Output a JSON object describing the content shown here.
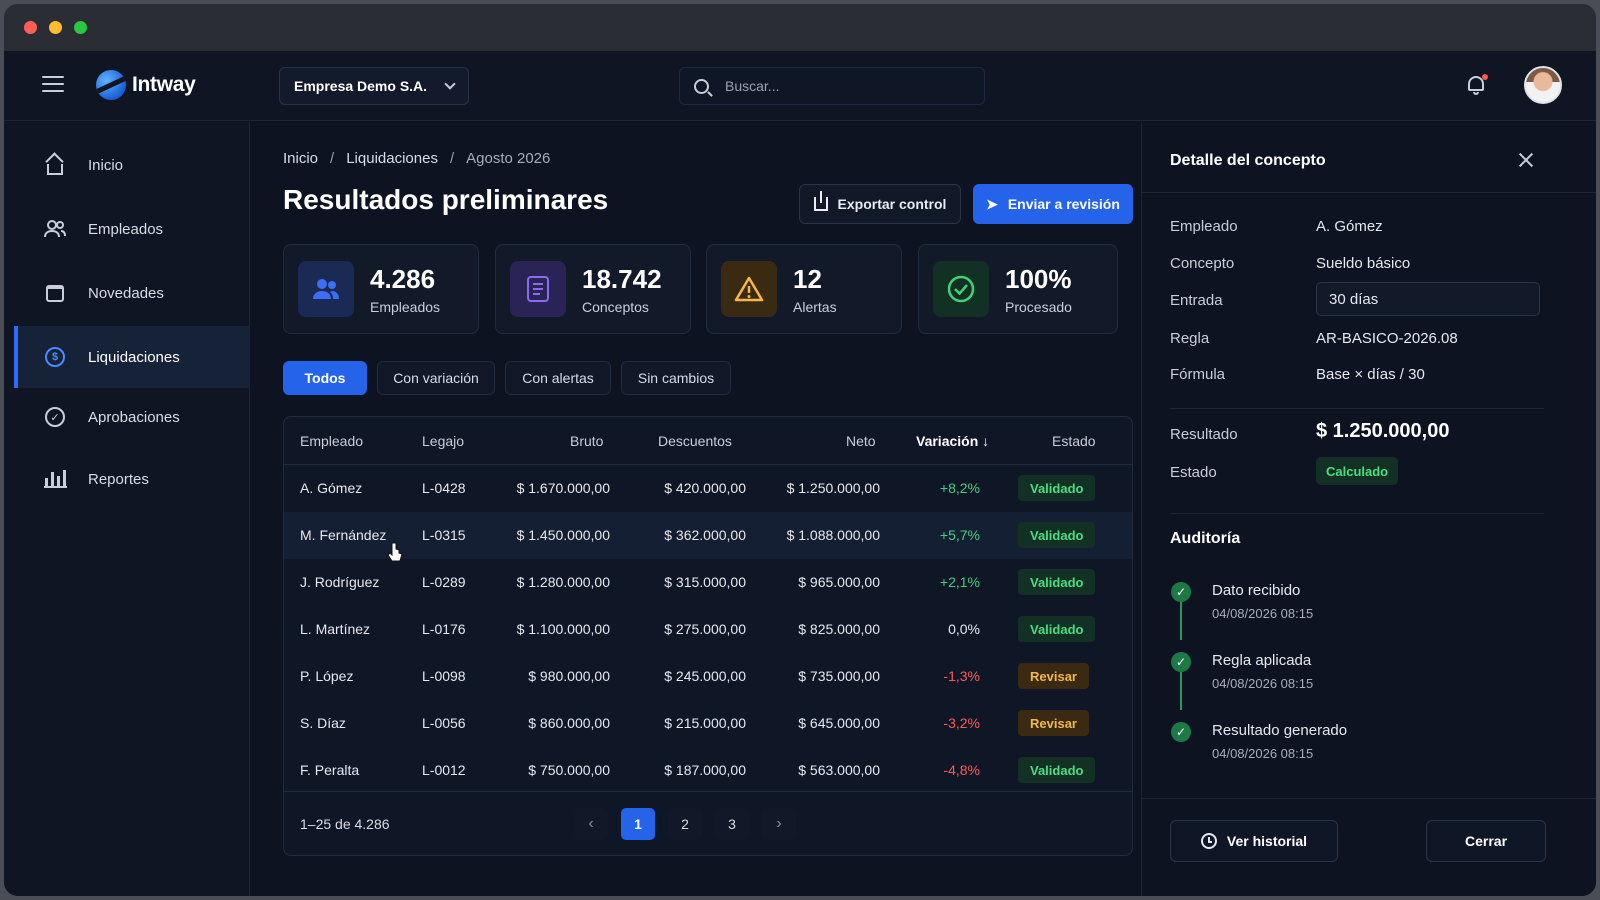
{
  "app": {
    "logo_text": "Intway",
    "company": "Empresa Demo S.A.",
    "search_placeholder": "Buscar..."
  },
  "sidebar": {
    "items": [
      {
        "label": "Inicio",
        "icon": "home-icon"
      },
      {
        "label": "Empleados",
        "icon": "users-icon"
      },
      {
        "label": "Novedades",
        "icon": "calendar-icon"
      },
      {
        "label": "Liquidaciones",
        "icon": "dollar-icon",
        "active": true
      },
      {
        "label": "Aprobaciones",
        "icon": "check-circle-icon"
      },
      {
        "label": "Reportes",
        "icon": "bar-chart-icon"
      }
    ]
  },
  "breadcrumb": [
    "Inicio",
    "Liquidaciones",
    "Agosto 2026"
  ],
  "page": {
    "title": "Resultados preliminares",
    "export_label": "Exportar control",
    "send_label": "Enviar a revisión"
  },
  "stats": [
    {
      "value": "4.286",
      "label": "Empleados",
      "icon": "users-icon",
      "color": "#3b6ff5"
    },
    {
      "value": "18.742",
      "label": "Conceptos",
      "icon": "document-icon",
      "color": "#8a6cf0"
    },
    {
      "value": "12",
      "label": "Alertas",
      "icon": "warning-icon",
      "color": "#f5b64a"
    },
    {
      "value": "100%",
      "label": "Procesado",
      "icon": "check-circle-icon",
      "color": "#41d17a"
    }
  ],
  "filters": [
    "Todos",
    "Con variación",
    "Con alertas",
    "Sin cambios"
  ],
  "table": {
    "headers": [
      "Empleado",
      "Legajo",
      "Bruto",
      "Descuentos",
      "Neto",
      "Variación",
      "Estado"
    ],
    "rows": [
      {
        "empleado": "A. Gómez",
        "legajo": "L-0428",
        "bruto": "$ 1.670.000,00",
        "descuentos": "$ 420.000,00",
        "neto": "$ 1.250.000,00",
        "variacion": "+8,2%",
        "estado": "Validado"
      },
      {
        "empleado": "M. Fernández",
        "legajo": "L-0315",
        "bruto": "$ 1.450.000,00",
        "descuentos": "$ 362.000,00",
        "neto": "$ 1.088.000,00",
        "variacion": "+5,7%",
        "estado": "Validado"
      },
      {
        "empleado": "J. Rodríguez",
        "legajo": "L-0289",
        "bruto": "$ 1.280.000,00",
        "descuentos": "$ 315.000,00",
        "neto": "$ 965.000,00",
        "variacion": "+2,1%",
        "estado": "Validado"
      },
      {
        "empleado": "L. Martínez",
        "legajo": "L-0176",
        "bruto": "$ 1.100.000,00",
        "descuentos": "$ 275.000,00",
        "neto": "$ 825.000,00",
        "variacion": "0,0%",
        "estado": "Validado"
      },
      {
        "empleado": "P. López",
        "legajo": "L-0098",
        "bruto": "$ 980.000,00",
        "descuentos": "$ 245.000,00",
        "neto": "$ 735.000,00",
        "variacion": "-1,3%",
        "estado": "Revisar"
      },
      {
        "empleado": "S. Díaz",
        "legajo": "L-0056",
        "bruto": "$ 860.000,00",
        "descuentos": "$ 215.000,00",
        "neto": "$ 645.000,00",
        "variacion": "-3,2%",
        "estado": "Revisar"
      },
      {
        "empleado": "F. Peralta",
        "legajo": "L-0012",
        "bruto": "$ 750.000,00",
        "descuentos": "$ 187.000,00",
        "neto": "$ 563.000,00",
        "variacion": "-4,8%",
        "estado": "Validado"
      }
    ],
    "count_label": "1–25 de 4.286",
    "pages": [
      "1",
      "2",
      "3"
    ],
    "current_page": "1"
  },
  "detail": {
    "title": "Detalle del concepto",
    "fields": [
      {
        "label": "Empleado",
        "value": "A. Gómez"
      },
      {
        "label": "Concepto",
        "value": "Sueldo básico"
      },
      {
        "label": "Entrada",
        "value": "30 días"
      },
      {
        "label": "Regla",
        "value": "AR-BASICO-2026.08"
      },
      {
        "label": "Fórmula",
        "value": "Base × días / 30"
      }
    ],
    "result_label": "Resultado",
    "result_value": "$ 1.250.000,00",
    "status_label": "Estado",
    "status_value": "Calculado",
    "audit_title": "Auditoría",
    "audit": [
      {
        "title": "Dato recibido",
        "date": "04/08/2026 08:15"
      },
      {
        "title": "Regla aplicada",
        "date": "04/08/2026 08:15"
      },
      {
        "title": "Resultado generado",
        "date": "04/08/2026 08:15"
      }
    ],
    "history_label": "Ver historial",
    "close_label": "Cerrar"
  }
}
